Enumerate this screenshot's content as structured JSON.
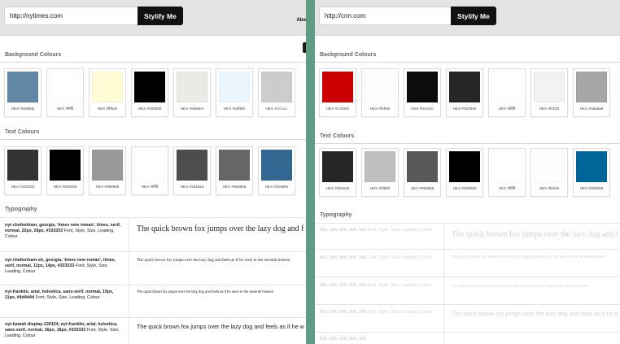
{
  "left": {
    "url_value": "http://nytimes.com",
    "button_label": "Stylify Me",
    "nav_text": "Abo",
    "bg_title": "Background Colours",
    "bg_swatches": [
      {
        "hex": "#6288a5",
        "label": "HEX #6288a5"
      },
      {
        "hex": "#ffffff",
        "label": "HEX #ffffff"
      },
      {
        "hex": "#fffbd4",
        "label": "HEX #fffbd4"
      },
      {
        "hex": "#000000",
        "label": "HEX #000000"
      },
      {
        "hex": "#e9ebe4",
        "label": "HEX #e9ebe4"
      },
      {
        "hex": "#ebf5fe",
        "label": "HEX #ebf5fe"
      },
      {
        "hex": "#cccccc",
        "label": "HEX #cccccc"
      }
    ],
    "text_title": "Text Colours",
    "text_swatches": [
      {
        "hex": "#333333",
        "label": "HEX #333333"
      },
      {
        "hex": "#000000",
        "label": "HEX #000000"
      },
      {
        "hex": "#999999",
        "label": "HEX #999999"
      },
      {
        "hex": "#ffffff",
        "label": "HEX #ffffff"
      },
      {
        "hex": "#4d4d4d",
        "label": "HEX #4d4d4d"
      },
      {
        "hex": "#666666",
        "label": "HEX #666666"
      },
      {
        "hex": "#326891",
        "label": "HEX #326891"
      }
    ],
    "typo_title": "Typography",
    "typography": [
      {
        "font_bold": "nyt-cheltenham, georgia, 'times new roman', times, serif, normal, 22px, 26px, #333333",
        "font_rest": " Font, Style, Size, Leading, Colour",
        "sample": "The quick brown fox jumps over the lazy dog and feels as if he were in the seventh heaven"
      },
      {
        "font_bold": "nyt-cheltenham-sh, georgia, 'times new roman', times, serif, normal, 12px, 14px, #333333",
        "font_rest": " Font, Style, Size, Leading, Colour",
        "sample": "The quick brown fox jumps over the lazy dog and feels as if he were in the seventh heaven"
      },
      {
        "font_bold": "nyt-franklin, arial, helvetica, sans-serif, normal, 10px, 11px, #4d4d4d",
        "font_rest": " Font, Style, Size, Leading, Colour",
        "sample": "The quick brown fox jumps over the lazy dog and feels as if he were in the seventh heaven"
      },
      {
        "font_bold": "nyt-kamak-display-130124, nyt-franklin, arial, helvetica, sans-serif, normal, 16px, 18px, #333333",
        "font_rest": " Font, Style, Size, Leading, Colour",
        "sample": "The quick brown fox jumps over the lazy dog and feels as if he were in the seventh heaven"
      }
    ]
  },
  "right": {
    "url_value": "http://cnn.com",
    "button_label": "Stylify Me",
    "bg_title": "Background Colours",
    "bg_swatches": [
      {
        "hex": "#cc0000",
        "label": "HEX #cc0000"
      },
      {
        "hex": "#fefefe",
        "label": "HEX #fefefe"
      },
      {
        "hex": "#0c0c0c",
        "label": "HEX #0c0c0c"
      },
      {
        "hex": "#262626",
        "label": "HEX #262626"
      },
      {
        "hex": "#ffffff",
        "label": "HEX #ffffff"
      },
      {
        "hex": "#f2f2f2",
        "label": "HEX #f2f2f2"
      },
      {
        "hex": "#a6a6a6",
        "label": "HEX #a6a6a6"
      }
    ],
    "text_title": "Text Colours",
    "text_swatches": [
      {
        "hex": "#262626",
        "label": "HEX #262626"
      },
      {
        "hex": "#bfbfbf",
        "label": "HEX #bfbfbf"
      },
      {
        "hex": "#595959",
        "label": "HEX #595959"
      },
      {
        "hex": "#000000",
        "label": "HEX #000000"
      },
      {
        "hex": "#ffffff",
        "label": "HEX #ffffff"
      },
      {
        "hex": "#fefefe",
        "label": "HEX #fefefe"
      },
      {
        "hex": "#006598",
        "label": "HEX #006598"
      }
    ],
    "typo_title": "Typography",
    "typography": [
      {
        "font_bold": "N/A, N/A, N/A, N/A, N/A",
        "font_rest": " Font, Style, Size, Leading, Colour",
        "sample": "The quick brown fox jumps over the lazy dog and feels as if he were in the seventh heaven"
      },
      {
        "font_bold": "N/A, N/A, N/A, N/A, N/A",
        "font_rest": " Font, Style, Size, Leading, Colour",
        "sample": "The quick brown fox jumps over the lazy dog and feels as if he were in the seventh heaven"
      },
      {
        "font_bold": "N/A, N/A, N/A, N/A, N/A",
        "font_rest": " Font, Style, Size, Leading, Colour",
        "sample": "The quick brown fox jumps over the lazy dog and feels as if he were in the seventh heaven"
      },
      {
        "font_bold": "N/A, N/A, N/A, N/A, N/A",
        "font_rest": " Font, Style, Size, Leading, Colour",
        "sample": "The quick brown fox jumps over the lazy dog and feels as if he were in the seventh heaven"
      },
      {
        "font_bold": "N/A, N/A, N/A, N/A, N/A",
        "font_rest": "",
        "sample": ""
      }
    ]
  },
  "colors": {
    "divider": "#5f9c86",
    "topbar": "#e4e4e4",
    "button": "#111111"
  }
}
